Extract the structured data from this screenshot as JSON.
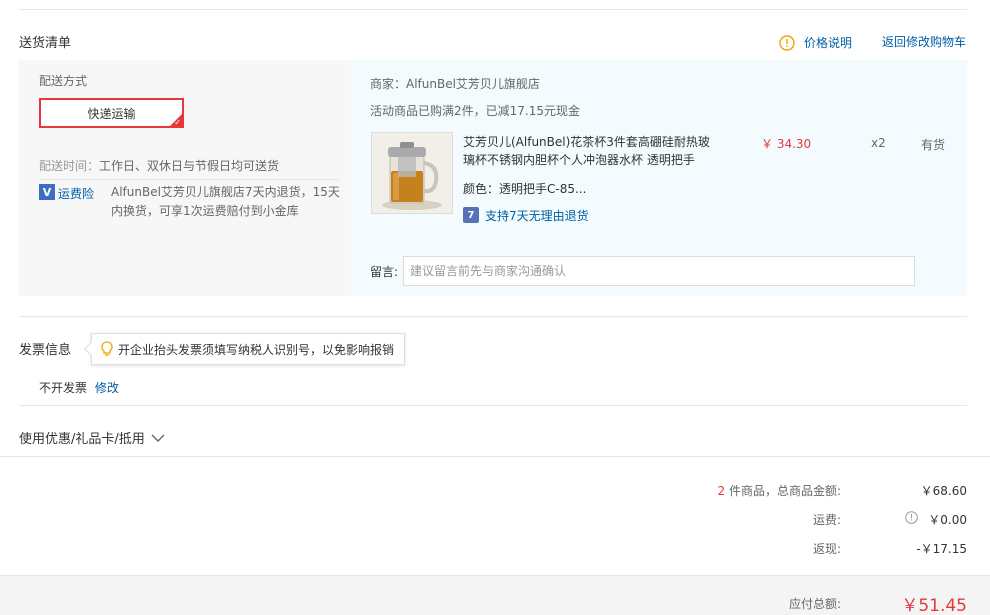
{
  "delivery_list": {
    "title": "送货清单",
    "price_note": "价格说明",
    "back_to_cart": "返回修改购物车"
  },
  "shipping": {
    "method_label": "配送方式",
    "method_value": "快递运输",
    "time_label": "配送时间：",
    "time_value": "工作日、双休日与节假日均可送货",
    "insurance_label": "运费险",
    "insurance_desc_1": "AlfunBel艾芳贝儿旗舰店7天内退货，15天",
    "insurance_desc_2": "内换货，可享1次运费赔付到小金库"
  },
  "store": {
    "merchant_line": "商家：AlfunBel艾芳贝儿旗舰店",
    "promo_line": "活动商品已购满2件，已减17.15元现金"
  },
  "product": {
    "name_1": "艾芳贝儿(AlfunBel)花茶杯3件套高硼硅耐热玻",
    "name_2": "璃杯不锈钢内胆杯个人冲泡器水杯 透明把手",
    "color": "颜色：透明把手C-85...",
    "return_policy": "支持7天无理由退货",
    "price": "￥ 34.30",
    "quantity": "x2",
    "stock": "有货"
  },
  "remark": {
    "label": "留言:",
    "placeholder": "建议留言前先与商家沟通确认"
  },
  "invoice": {
    "title": "发票信息",
    "tip": "开企业抬头发票须填写纳税人识别号，以免影响报销",
    "status": "不开发票",
    "edit": "修改"
  },
  "coupon": {
    "title": "使用优惠/礼品卡/抵用"
  },
  "summary": {
    "count": "2",
    "count_label": "件商品，总商品金额:",
    "goods_total": "￥68.60",
    "freight_label": "运费:",
    "freight_value": "￥0.00",
    "rebate_label": "返现:",
    "rebate_value": "-￥17.15",
    "payable_label": "应付总额:",
    "payable_value": "￥51.45"
  },
  "colors": {
    "accent_red": "#e4393c",
    "link_blue": "#005ea7",
    "warn_orange": "#f4a100"
  }
}
